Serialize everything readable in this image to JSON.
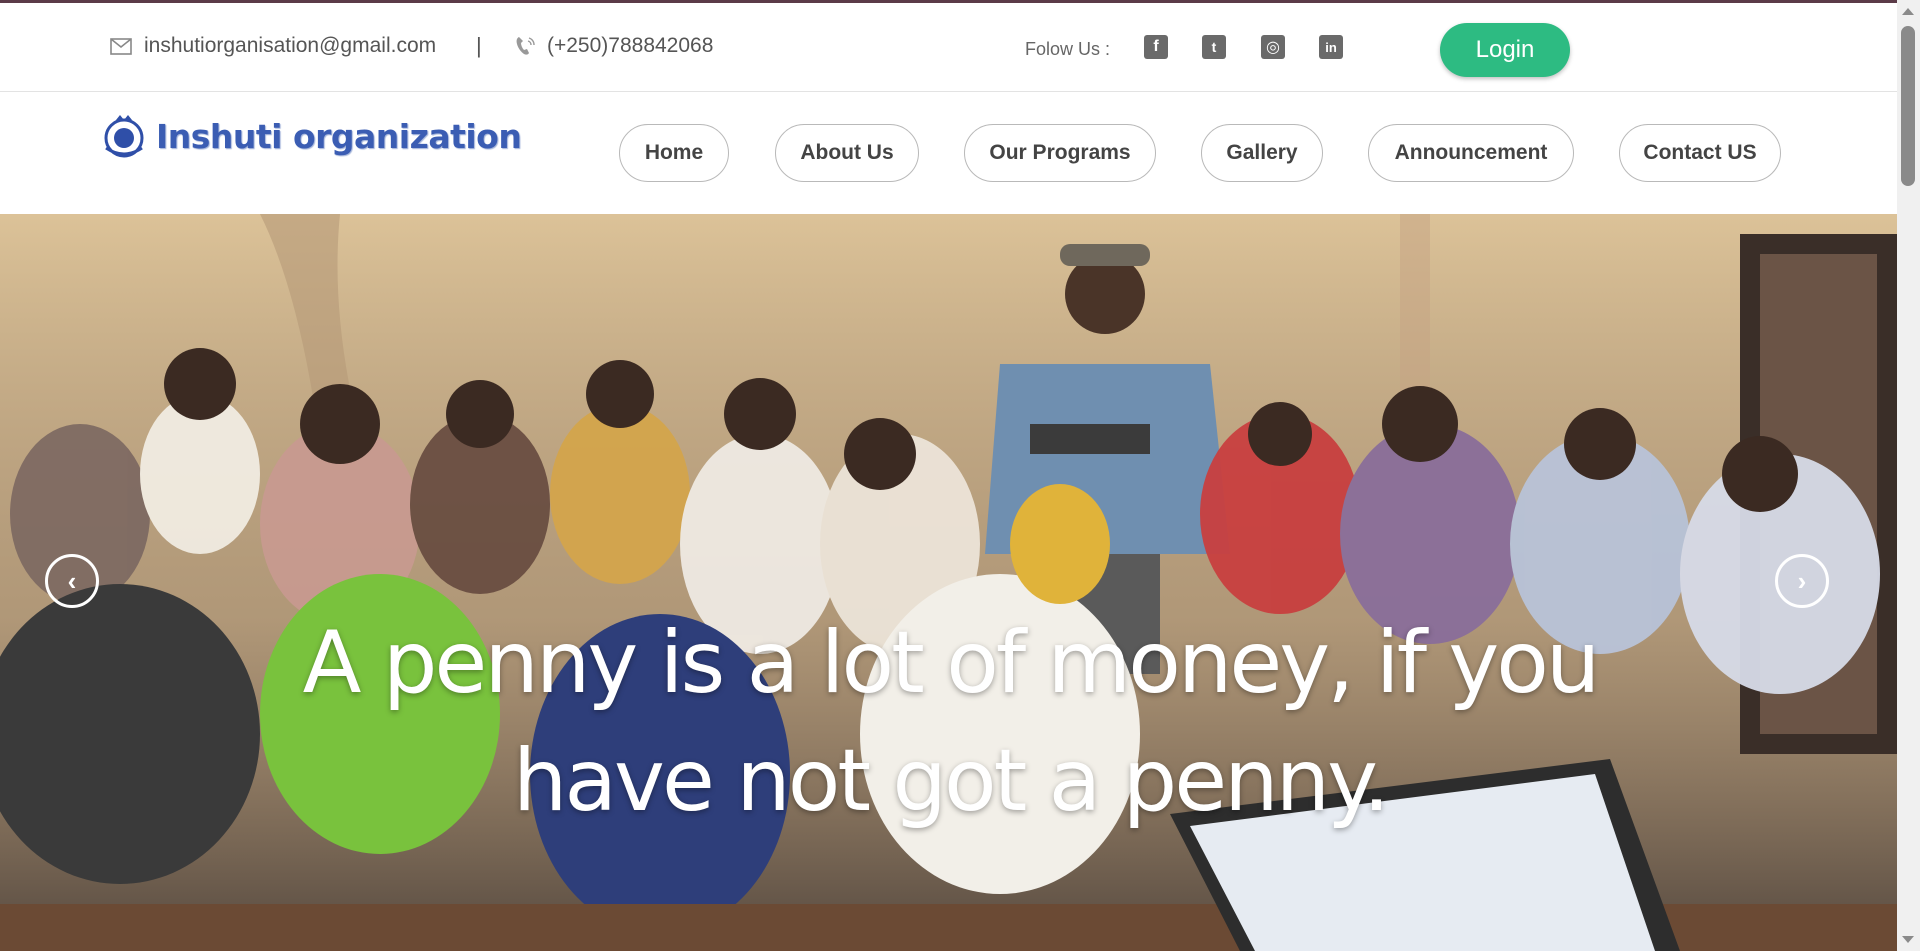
{
  "topbar": {
    "email": "inshutiorganisation@gmail.com",
    "separator": "|",
    "phone": "(+250)788842068",
    "follow_label": "Folow Us :",
    "social": [
      {
        "name": "facebook-icon",
        "glyph": "f"
      },
      {
        "name": "twitter-icon",
        "glyph": "t"
      },
      {
        "name": "instagram-icon",
        "glyph": "◎"
      },
      {
        "name": "linkedin-icon",
        "glyph": "in"
      }
    ],
    "login_label": "Login"
  },
  "brand": {
    "name": "Inshuti organization"
  },
  "nav": {
    "home": "Home",
    "about": "About Us",
    "programs": "Our Programs",
    "gallery": "Gallery",
    "announcement": "Announcement",
    "contact": "Contact US"
  },
  "hero": {
    "quote": "A penny is a lot of money, if you have not got a penny."
  },
  "colors": {
    "accent_green": "#2dbb82",
    "brand_blue": "#3b5db3"
  }
}
